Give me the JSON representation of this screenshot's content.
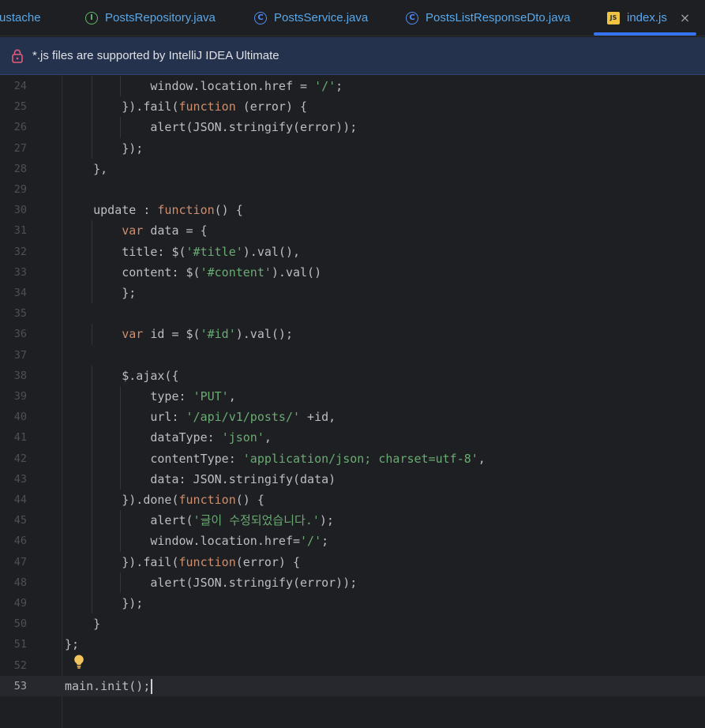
{
  "tabs": [
    {
      "label": "ustache",
      "icon": "none"
    },
    {
      "label": "PostsRepository.java",
      "icon": "interface-icon",
      "glyph": "I"
    },
    {
      "label": "PostsService.java",
      "icon": "class-icon",
      "glyph": "C"
    },
    {
      "label": "PostsListResponseDto.java",
      "icon": "class-icon",
      "glyph": "C"
    },
    {
      "label": "index.js",
      "icon": "js-file-icon",
      "glyph": "JS",
      "active": true,
      "close": "×"
    }
  ],
  "banner": {
    "message": "*.js files are supported by IntelliJ IDEA Ultimate",
    "icon": "lock-icon"
  },
  "editor": {
    "current_line": 53,
    "lines": [
      {
        "n": "24",
        "code": "            window.location.href = '/';"
      },
      {
        "n": "25",
        "code": "        }).fail(function (error) {"
      },
      {
        "n": "26",
        "code": "            alert(JSON.stringify(error));"
      },
      {
        "n": "27",
        "code": "        });"
      },
      {
        "n": "28",
        "code": "    },"
      },
      {
        "n": "29",
        "code": ""
      },
      {
        "n": "30",
        "code": "    update : function() {"
      },
      {
        "n": "31",
        "code": "        var data = {"
      },
      {
        "n": "32",
        "code": "        title: $('#title').val(),"
      },
      {
        "n": "33",
        "code": "        content: $('#content').val()"
      },
      {
        "n": "34",
        "code": "        };"
      },
      {
        "n": "35",
        "code": ""
      },
      {
        "n": "36",
        "code": "        var id = $('#id').val();"
      },
      {
        "n": "37",
        "code": ""
      },
      {
        "n": "38",
        "code": "        $.ajax({"
      },
      {
        "n": "39",
        "code": "            type: 'PUT',"
      },
      {
        "n": "40",
        "code": "            url: '/api/v1/posts/' +id,"
      },
      {
        "n": "41",
        "code": "            dataType: 'json',"
      },
      {
        "n": "42",
        "code": "            contentType: 'application/json; charset=utf-8',"
      },
      {
        "n": "43",
        "code": "            data: JSON.stringify(data)"
      },
      {
        "n": "44",
        "code": "        }).done(function() {"
      },
      {
        "n": "45",
        "code": "            alert('글이 수정되었습니다.');"
      },
      {
        "n": "46",
        "code": "            window.location.href='/';"
      },
      {
        "n": "47",
        "code": "        }).fail(function(error) {"
      },
      {
        "n": "48",
        "code": "            alert(JSON.stringify(error));"
      },
      {
        "n": "49",
        "code": "        });"
      },
      {
        "n": "50",
        "code": "    }"
      },
      {
        "n": "51",
        "code": "};"
      },
      {
        "n": "52",
        "code": ""
      },
      {
        "n": "53",
        "code": "main.init();"
      }
    ]
  },
  "colors": {
    "background": "#1e1f22",
    "keyword": "#cf8e6d",
    "string": "#6aab73",
    "text": "#bcbec4",
    "accent": "#3574f0",
    "banner": "#25324d"
  }
}
